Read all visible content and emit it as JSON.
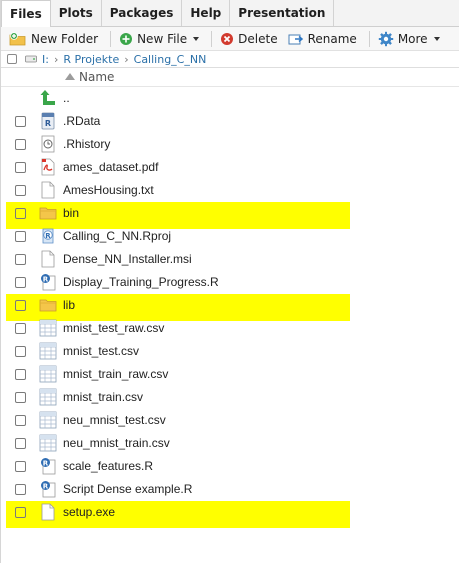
{
  "tabs": [
    {
      "label": "Files",
      "active": true
    },
    {
      "label": "Plots",
      "active": false
    },
    {
      "label": "Packages",
      "active": false
    },
    {
      "label": "Help",
      "active": false
    },
    {
      "label": "Presentation",
      "active": false
    }
  ],
  "toolbar": {
    "new_folder": "New Folder",
    "new_file": "New File",
    "delete": "Delete",
    "rename": "Rename",
    "more": "More"
  },
  "breadcrumb": {
    "root": "I:",
    "items": [
      "R Projekte",
      "Calling_C_NN"
    ]
  },
  "columns": {
    "name": "Name"
  },
  "files": [
    {
      "name": "..",
      "icon": "up-arrow-icon",
      "highlighted": false,
      "checkbox": false
    },
    {
      "name": ".RData",
      "icon": "rdata-icon",
      "highlighted": false,
      "checkbox": true
    },
    {
      "name": ".Rhistory",
      "icon": "history-icon",
      "highlighted": false,
      "checkbox": true
    },
    {
      "name": "ames_dataset.pdf",
      "icon": "pdf-icon",
      "highlighted": false,
      "checkbox": true
    },
    {
      "name": "AmesHousing.txt",
      "icon": "text-file-icon",
      "highlighted": false,
      "checkbox": true
    },
    {
      "name": "bin",
      "icon": "folder-icon",
      "highlighted": true,
      "checkbox": true
    },
    {
      "name": "Calling_C_NN.Rproj",
      "icon": "rproj-icon",
      "highlighted": false,
      "checkbox": true
    },
    {
      "name": "Dense_NN_Installer.msi",
      "icon": "file-icon",
      "highlighted": false,
      "checkbox": true
    },
    {
      "name": "Display_Training_Progress.R",
      "icon": "r-script-icon",
      "highlighted": false,
      "checkbox": true
    },
    {
      "name": "lib",
      "icon": "folder-icon",
      "highlighted": true,
      "checkbox": true
    },
    {
      "name": "mnist_test_raw.csv",
      "icon": "csv-icon",
      "highlighted": false,
      "checkbox": true
    },
    {
      "name": "mnist_test.csv",
      "icon": "csv-icon",
      "highlighted": false,
      "checkbox": true
    },
    {
      "name": "mnist_train_raw.csv",
      "icon": "csv-icon",
      "highlighted": false,
      "checkbox": true
    },
    {
      "name": "mnist_train.csv",
      "icon": "csv-icon",
      "highlighted": false,
      "checkbox": true
    },
    {
      "name": "neu_mnist_test.csv",
      "icon": "csv-icon",
      "highlighted": false,
      "checkbox": true
    },
    {
      "name": "neu_mnist_train.csv",
      "icon": "csv-icon",
      "highlighted": false,
      "checkbox": true
    },
    {
      "name": "scale_features.R",
      "icon": "r-script-icon",
      "highlighted": false,
      "checkbox": true
    },
    {
      "name": "Script Dense example.R",
      "icon": "r-script-icon",
      "highlighted": false,
      "checkbox": true
    },
    {
      "name": "setup.exe",
      "icon": "file-icon",
      "highlighted": true,
      "checkbox": true
    }
  ],
  "colors": {
    "highlight": "#ffff00",
    "link": "#2b70a8",
    "folder": "#f4c64a"
  }
}
